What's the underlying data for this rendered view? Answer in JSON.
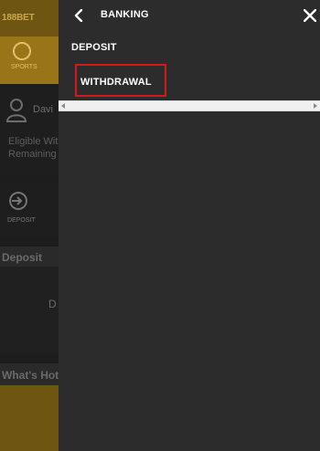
{
  "background": {
    "logo_text": "188BET",
    "sports_label": "SPORTS",
    "user_name": "Davi",
    "eligible_line1": "Eligible Wit",
    "eligible_line2": "Remaining",
    "deposit_label": "DEPOSIT",
    "section_deposit": "Deposit",
    "card_text": "D",
    "section_whats_hot": "What's Hot"
  },
  "drawer": {
    "title": "BANKING",
    "items": [
      {
        "label": "DEPOSIT"
      },
      {
        "label": "WITHDRAWAL",
        "highlighted": true
      }
    ]
  },
  "icons": {
    "back": "chevron-left-icon",
    "close": "close-icon",
    "user": "user-icon",
    "sports": "soccer-ball-icon",
    "deposit": "deposit-arrow-icon"
  },
  "colors": {
    "drawer_bg": "#2c2c2c",
    "highlight": "#d11a1a",
    "brand_gold": "#9a7418"
  }
}
